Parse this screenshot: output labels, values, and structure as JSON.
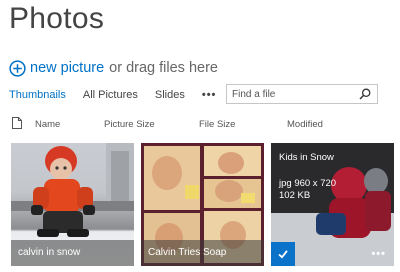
{
  "page": {
    "title": "Photos"
  },
  "new_row": {
    "link": "new picture",
    "rest": "or drag files here"
  },
  "views": {
    "tabs": [
      "Thumbnails",
      "All Pictures",
      "Slides"
    ],
    "more": "•••"
  },
  "search": {
    "placeholder": "Find a file"
  },
  "columns": {
    "name": "Name",
    "picture_size": "Picture Size",
    "file_size": "File Size",
    "modified": "Modified"
  },
  "tiles": [
    {
      "caption": "calvin in snow"
    },
    {
      "caption": "Calvin Tries Soap"
    },
    {
      "title": "Kids in Snow",
      "type_size": "jpg 960 x 720",
      "file_size": "102 KB",
      "more": "•••"
    }
  ],
  "colors": {
    "accent": "#0072c6",
    "selected": "#0a73c9"
  }
}
